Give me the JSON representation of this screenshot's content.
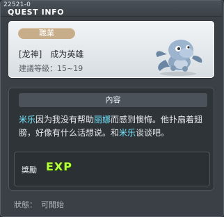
{
  "window": {
    "quest_id": "22521-0",
    "title": "QUEST INFO"
  },
  "header": {
    "job_badge": "職業",
    "quest_name": "[龙神]　成为英雄",
    "recommended_level": "建議等級：15~19"
  },
  "content": {
    "section_title": "內容",
    "description": [
      {
        "text": "米乐",
        "highlight": true
      },
      {
        "text": "因为我没有帮助",
        "highlight": false
      },
      {
        "text": "丽娜",
        "highlight": true
      },
      {
        "text": "而感到懊悔。他扑扇着翅膀，好像有什么话想说。和",
        "highlight": false
      },
      {
        "text": "米乐",
        "highlight": true
      },
      {
        "text": "谈谈吧。",
        "highlight": false
      }
    ]
  },
  "reward": {
    "label": "獎勵",
    "exp_label": "EXP"
  },
  "status": {
    "label": "狀態：",
    "value": "可開始"
  },
  "colors": {
    "highlight": "#74e7ff",
    "badge": "#c8ad8a",
    "exp": "#b6ff3f"
  },
  "icons": {
    "mascot": "dragon-mascot-icon",
    "exp": "exp-icon"
  }
}
